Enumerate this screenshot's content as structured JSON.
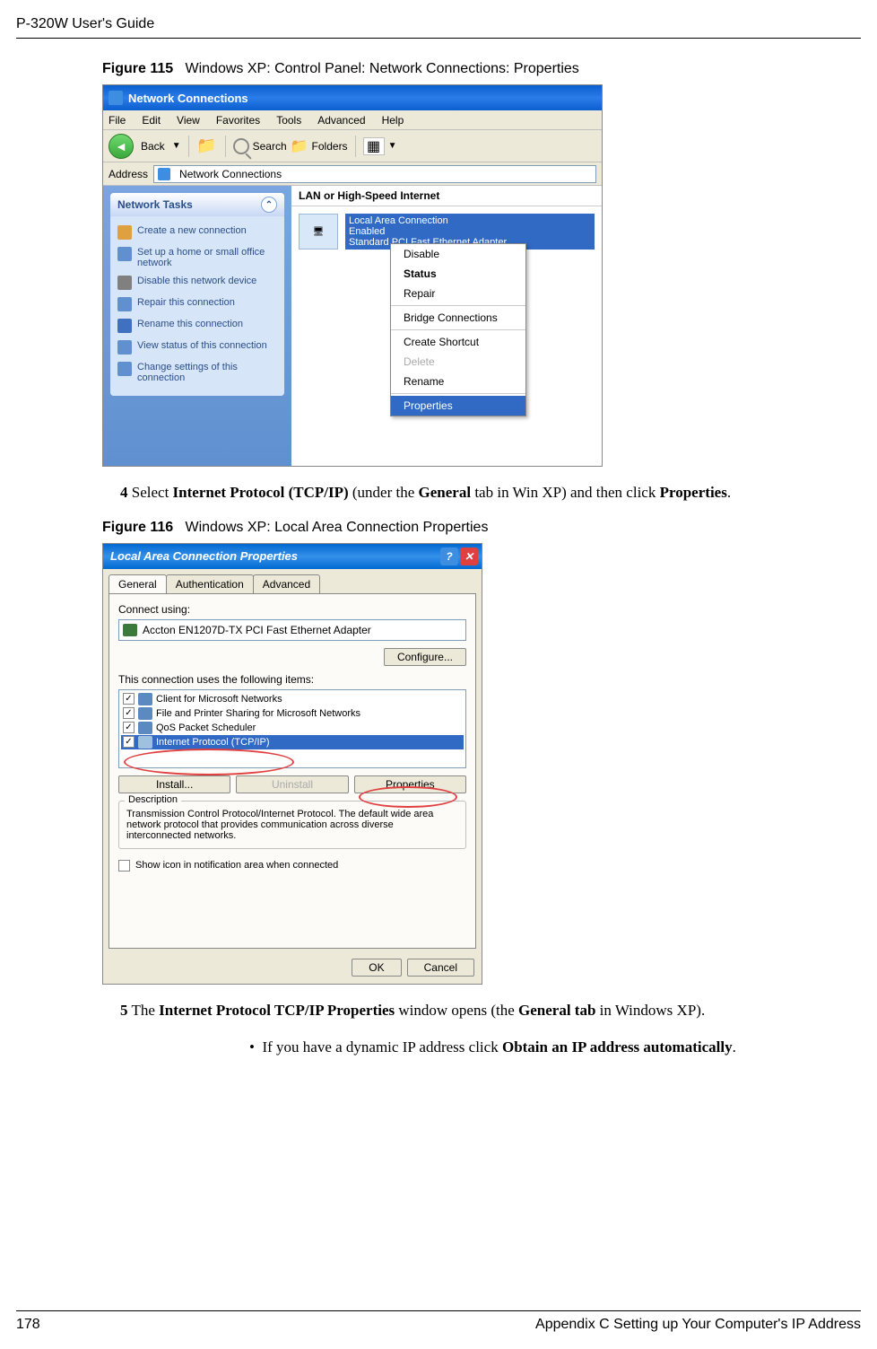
{
  "header": {
    "title": "P-320W User's Guide"
  },
  "figure115": {
    "label": "Figure 115",
    "title": "Windows XP: Control Panel: Network Connections: Properties",
    "window_title": "Network Connections",
    "menu": {
      "file": "File",
      "edit": "Edit",
      "view": "View",
      "favorites": "Favorites",
      "tools": "Tools",
      "advanced": "Advanced",
      "help": "Help"
    },
    "toolbar": {
      "back": "Back",
      "search": "Search",
      "folders": "Folders"
    },
    "address_label": "Address",
    "address_value": "Network Connections",
    "tasks_header": "Network Tasks",
    "tasks": [
      "Create a new connection",
      "Set up a home or small office network",
      "Disable this network device",
      "Repair this connection",
      "Rename this connection",
      "View status of this connection",
      "Change settings of this connection"
    ],
    "section_header": "LAN or High-Speed Internet",
    "lac_lines": {
      "l1": "Local Area Connection",
      "l2": "Enabled",
      "l3": "Standard PCI Fast Ethernet Adapter"
    },
    "context_menu": {
      "disable": "Disable",
      "status": "Status",
      "repair": "Repair",
      "bridge": "Bridge Connections",
      "shortcut": "Create Shortcut",
      "delete": "Delete",
      "rename": "Rename",
      "properties": "Properties"
    }
  },
  "step4": {
    "num": "4",
    "before": "Select ",
    "bold1": "Internet Protocol (TCP/IP)",
    "mid": " (under the ",
    "bold2": "General",
    "after": " tab in Win XP) and then click ",
    "bold3": "Properties",
    "end": "."
  },
  "figure116": {
    "label": "Figure 116",
    "title": "Windows XP: Local Area Connection Properties",
    "window_title": "Local Area Connection Properties",
    "tabs": {
      "general": "General",
      "auth": "Authentication",
      "advanced": "Advanced"
    },
    "connect_using": "Connect using:",
    "adapter": "Accton EN1207D-TX PCI Fast Ethernet Adapter",
    "configure": "Configure...",
    "items_label": "This connection uses the following items:",
    "items": [
      "Client for Microsoft Networks",
      "File and Printer Sharing for Microsoft Networks",
      "QoS Packet Scheduler",
      "Internet Protocol (TCP/IP)"
    ],
    "buttons": {
      "install": "Install...",
      "uninstall": "Uninstall",
      "properties": "Properties"
    },
    "desc_label": "Description",
    "desc_text": "Transmission Control Protocol/Internet Protocol. The default wide area network protocol that provides communication across diverse interconnected networks.",
    "show_icon": "Show icon in notification area when connected",
    "ok": "OK",
    "cancel": "Cancel"
  },
  "step5": {
    "num": "5",
    "before": "The ",
    "bold1": "Internet Protocol TCP/IP Properties",
    "mid": " window opens (the ",
    "bold2": "General tab",
    "after": " in Windows XP)."
  },
  "bullet": {
    "before": "If you have a dynamic IP address click ",
    "bold1": "Obtain an IP address automatically",
    "end": "."
  },
  "footer": {
    "page": "178",
    "right": "Appendix C Setting up Your Computer's IP Address"
  }
}
